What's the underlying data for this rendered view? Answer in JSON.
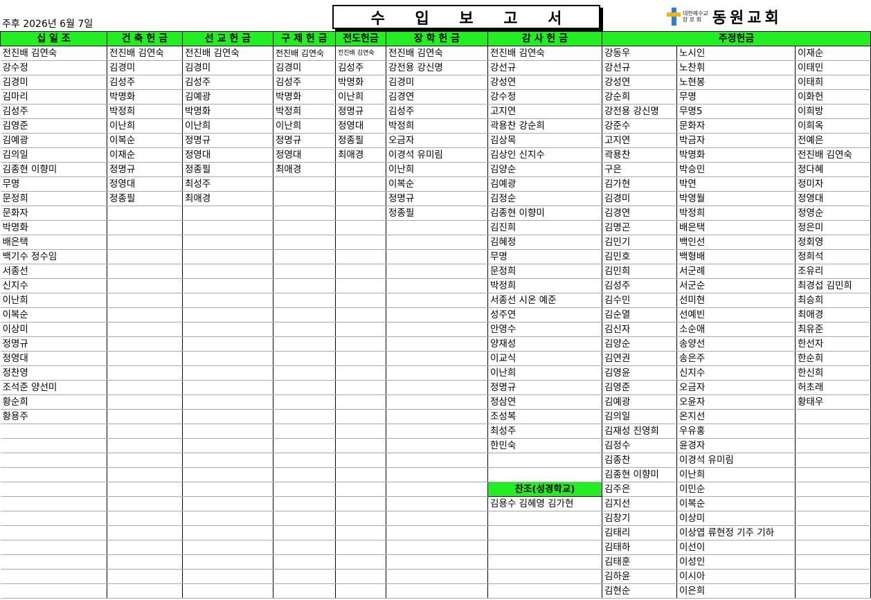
{
  "date": "주후 2026년 6월 7일",
  "title": "수 입 보 고 서",
  "logo": {
    "small_top": "대한예수교",
    "small_bottom": "장 로 회",
    "name": "동원교회"
  },
  "headers": {
    "tithe": "십 일 조",
    "building": "건 축 헌 금",
    "mission": "선 교 헌 금",
    "relief": "구 제 헌 금",
    "evangelism": "전도헌금",
    "scholarship": "장 학 헌 금",
    "thanks": "감 사 헌 금",
    "weekly": "주정헌금"
  },
  "columns": {
    "tithe": [
      "전진배 김연숙",
      "강수정",
      "김경미",
      "김마리",
      "김성주",
      "김영준",
      "김예광",
      "김의일",
      "김종현 이향미",
      "무명",
      "문정희",
      "문화자",
      "박명화",
      "배은택",
      "백기수 정수임",
      "서종선",
      "신지수",
      "이난희",
      "이복순",
      "이상미",
      "정명규",
      "정영대",
      "정찬영",
      "조석준 양선미",
      "황순희",
      "황용주"
    ],
    "building": [
      "전진배 김연숙",
      "김경미",
      "김성주",
      "박명화",
      "박정희",
      "이난희",
      "이복순",
      "이재순",
      "정명규",
      "정영대",
      "정종필"
    ],
    "mission": [
      "전진배 김연숙",
      "김경미",
      "김성주",
      "김예광",
      "박명화",
      "이난희",
      "정명규",
      "정영대",
      "정종필",
      "최성주",
      "최애경"
    ],
    "relief": [
      "전진배 김연숙",
      "김경미",
      "김성주",
      "박명화",
      "박정희",
      "이난희",
      "정명규",
      "정영대",
      "최애경"
    ],
    "evangelism": [
      "전진배 김연숙",
      "김성주",
      "박명화",
      "이난희",
      "정명규",
      "정영대",
      "정종필",
      "최애경"
    ],
    "scholarship": [
      "전진배 김연숙",
      "강전용 강신명",
      "김경미",
      "김경연",
      "김성주",
      "박정희",
      "오금자",
      "이경석 유미림",
      "이난희",
      "이복순",
      "정명규",
      "정종필"
    ],
    "thanks": [
      "전진배 김연숙",
      "강선규",
      "강성연",
      "강수정",
      "고지연",
      "곽용찬 강순희",
      "김상목",
      "김상인 신지수",
      "김양순",
      "김예광",
      "김정순",
      "김종현 이향미",
      "김진희",
      "김혜정",
      "무명",
      "문정희",
      "박정희",
      "서종선 시온 예준",
      "성주연",
      "안영수",
      "양재성",
      "이교식",
      "이난희",
      "정명규",
      "정삼연",
      "조성복",
      "최성주",
      "한민숙"
    ],
    "weekly1": [
      "강동우",
      "강선규",
      "강성연",
      "강순희",
      "강전용 강신명",
      "강준수",
      "고지연",
      "곽용찬",
      "구은",
      "김가현",
      "김경미",
      "김경연",
      "김명곤",
      "김민기",
      "김민호",
      "김민희",
      "김성주",
      "김수민",
      "김순열",
      "김신자",
      "김양순",
      "김연권",
      "김영윤",
      "김영준",
      "김예광",
      "김의일",
      "김재성 진영희",
      "김정수",
      "김종찬",
      "김종현 이향미",
      "김주은",
      "김지선",
      "김창기",
      "김태리",
      "김태하",
      "김태훈",
      "김하윤",
      "김현순"
    ],
    "weekly2": [
      "노시인",
      "노찬휘",
      "노현봉",
      "무명",
      "무명5",
      "문화자",
      "박금자",
      "박명화",
      "박승민",
      "박연",
      "박영월",
      "박정희",
      "배은택",
      "백인선",
      "백형배",
      "서군례",
      "서군순",
      "선미현",
      "선예빈",
      "소순애",
      "송양선",
      "송은주",
      "신지수",
      "오금자",
      "오윤자",
      "온지선",
      "우유홍",
      "윤경자",
      "이경석 유미림",
      "이난희",
      "이민순",
      "이복순",
      "이상미",
      "이상엽 류현정 기주 기하",
      "이선이",
      "이성인",
      "이시아",
      "이은희"
    ],
    "weekly3": [
      "이재순",
      "이태민",
      "이태희",
      "이화헌",
      "이희방",
      "이희옥",
      "전예은",
      "전진배 김연숙",
      "정다혜",
      "정미자",
      "정영대",
      "정영순",
      "정은미",
      "정회영",
      "정희석",
      "조유리",
      "최경섭 김민희",
      "최승희",
      "최애경",
      "최유준",
      "한선자",
      "한순희",
      "한신희",
      "허초래",
      "황태우"
    ]
  },
  "choir": {
    "label": "찬조(성경학교)",
    "names": "김용수 김혜영 김가현"
  }
}
